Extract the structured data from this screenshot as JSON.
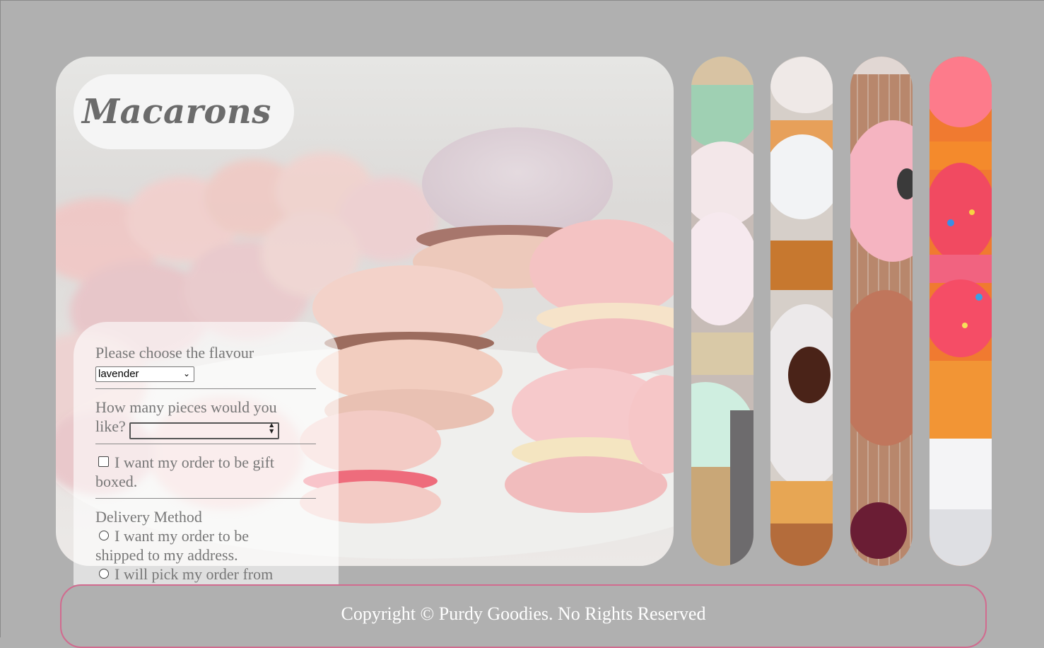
{
  "header": {
    "title": "Macarons"
  },
  "form": {
    "flavour_label": "Please choose the flavour",
    "flavour_value": "lavender",
    "pieces_label_1": "How many pieces would you",
    "pieces_label_2": "like?",
    "pieces_value": "",
    "gift_label_1": "I want my order to be gift",
    "gift_label_2": "boxed.",
    "gift_checked": false,
    "delivery_heading": "Delivery Method",
    "ship_label_1": "I want my order to be",
    "ship_label_2": "shipped to my address.",
    "pickup_label": "I will pick my order from"
  },
  "gallery": {
    "images": [
      "cupcakes",
      "linzer-cookies",
      "donuts",
      "cupcakes-with-sprinkles"
    ]
  },
  "footer": {
    "copyright": "Copyright © Purdy Goodies. No Rights Reserved"
  },
  "colors": {
    "background": "#b0b0b0",
    "footer_border": "#d16b8f",
    "title_text": "#6b6b6b"
  }
}
